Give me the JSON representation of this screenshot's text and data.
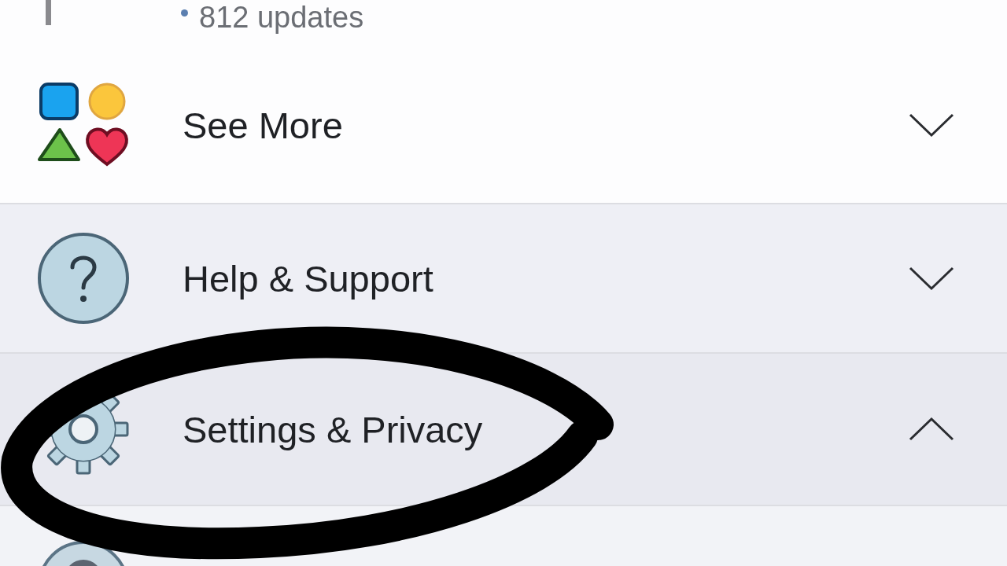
{
  "updates": {
    "text": "812 updates"
  },
  "menu": [
    {
      "kind": "shapes",
      "label": "See More",
      "expanded": false
    },
    {
      "kind": "help",
      "label": "Help & Support",
      "expanded": false
    },
    {
      "kind": "gear",
      "label": "Settings & Privacy",
      "expanded": true
    },
    {
      "kind": "partial"
    }
  ]
}
